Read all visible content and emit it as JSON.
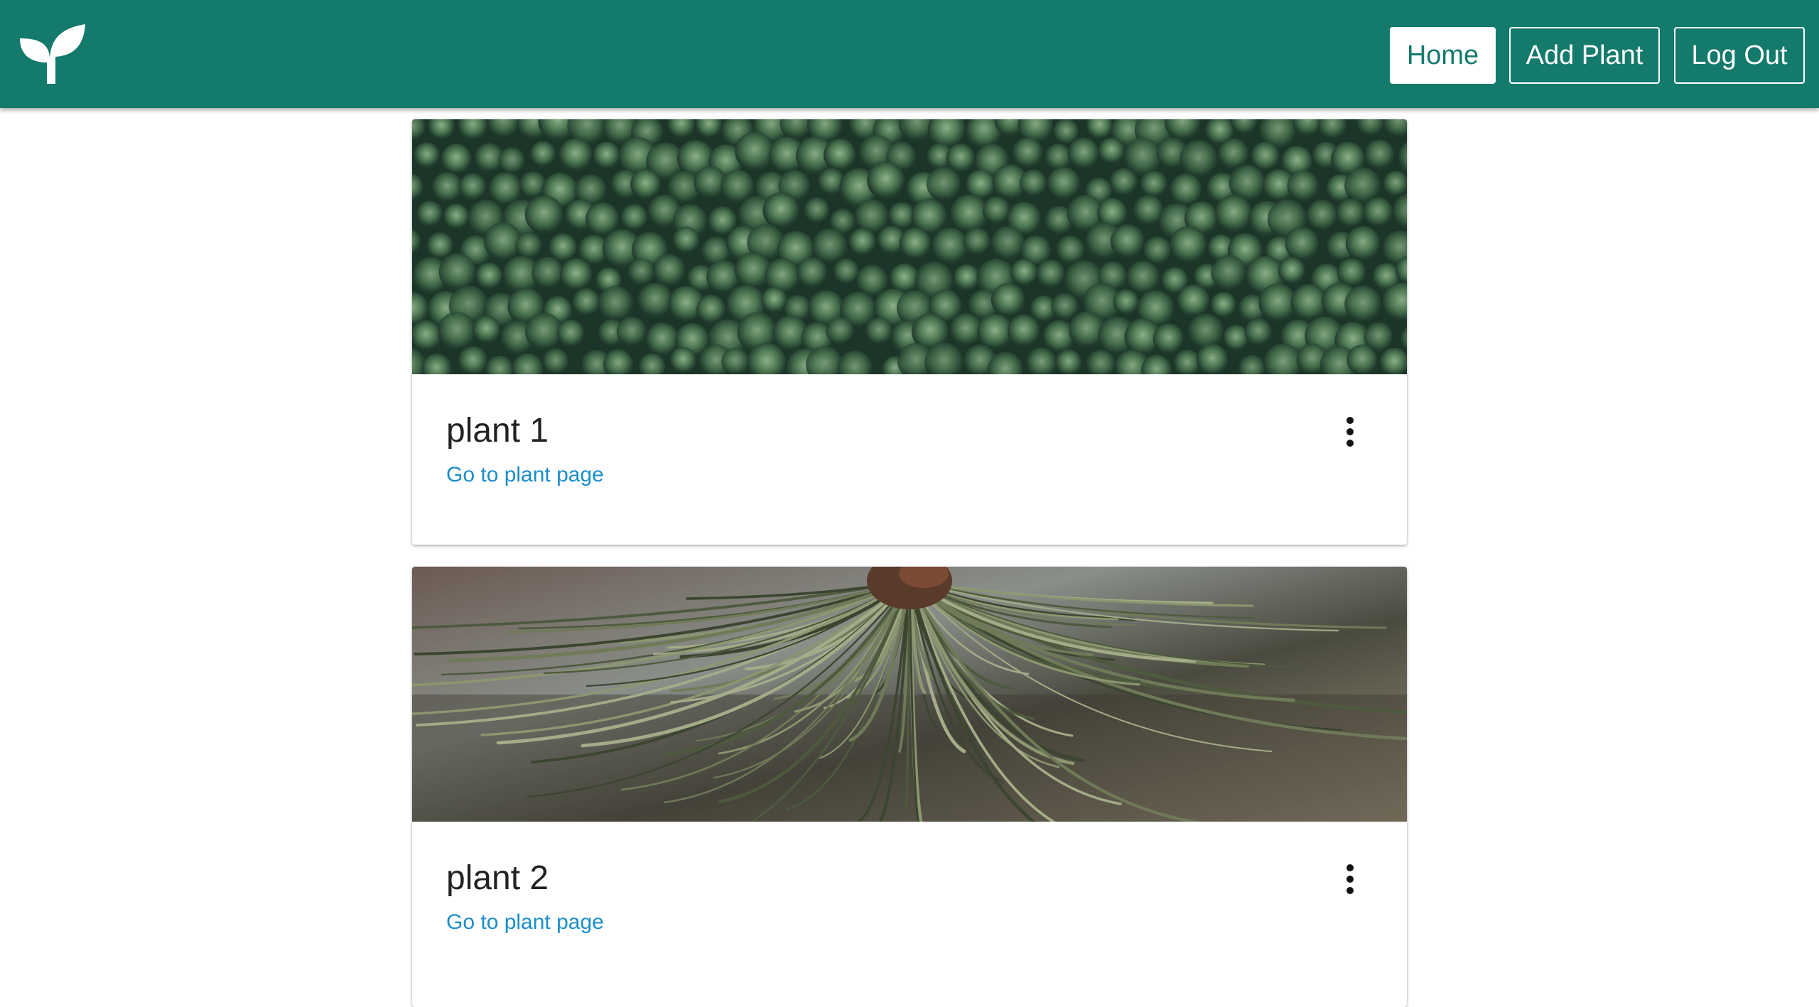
{
  "navbar": {
    "background": "#147a6c",
    "logo_icon": "sprout-icon",
    "buttons": [
      {
        "label": "Home",
        "active": true
      },
      {
        "label": "Add Plant",
        "active": false
      },
      {
        "label": "Log Out",
        "active": false
      }
    ]
  },
  "cards": [
    {
      "title": "plant 1",
      "link": "Go to plant page",
      "image": "aerial-forest-photo",
      "menu_icon": "more-vertical-icon"
    },
    {
      "title": "plant 2",
      "link": "Go to plant page",
      "image": "pine-needles-photo",
      "menu_icon": "more-vertical-icon"
    }
  ],
  "colors": {
    "accent": "#147a6c",
    "link": "#1a8ec9"
  }
}
